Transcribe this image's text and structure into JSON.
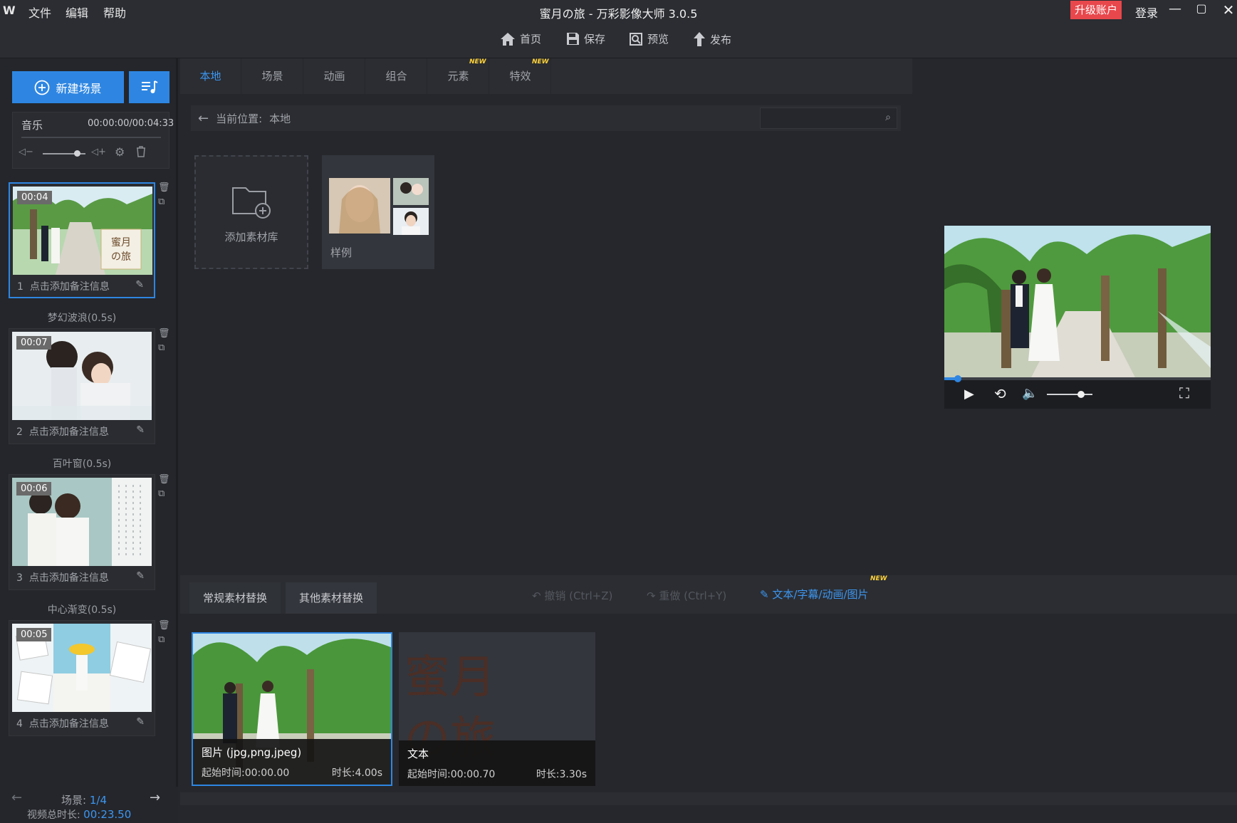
{
  "menu": {
    "app_logo": "W",
    "file": "文件",
    "edit": "编辑",
    "help": "帮助"
  },
  "window": {
    "title": "蜜月の旅 - 万彩影像大师 3.0.5",
    "upgrade": "升级账户",
    "login": "登录"
  },
  "toolbar": {
    "home": "首页",
    "save": "保存",
    "preview": "预览",
    "publish": "发布"
  },
  "left": {
    "new_scene": "新建场景",
    "music_label": "音乐",
    "music_time": "00:00:00/00:04:33",
    "music_volume": 0.8,
    "scenes": [
      {
        "time": "00:04",
        "num": "1",
        "note": "点击添加备注信息",
        "title_line1": "蜜月",
        "title_line2": "の旅"
      },
      {
        "time": "00:07",
        "num": "2",
        "note": "点击添加备注信息"
      },
      {
        "time": "00:06",
        "num": "3",
        "note": "点击添加备注信息"
      },
      {
        "time": "00:05",
        "num": "4",
        "note": "点击添加备注信息"
      }
    ],
    "transitions": [
      "梦幻波浪(0.5s)",
      "百叶窗(0.5s)",
      "中心渐变(0.5s)"
    ],
    "footer_scene_label": "场景:",
    "footer_scene_value": "1/4",
    "footer_duration_label": "视频总时长:",
    "footer_duration_value": "00:23.50"
  },
  "tabs": [
    "本地",
    "场景",
    "动画",
    "组合",
    "元素",
    "特效"
  ],
  "new_badge": "NEW",
  "breadcrumb": {
    "label": "当前位置:",
    "value": "本地"
  },
  "library": {
    "add": "添加素材库",
    "sample": "样例"
  },
  "player": {
    "progress": 0.05,
    "volume": 0.75
  },
  "bottom": {
    "tab1": "常规素材替换",
    "tab2": "其他素材替换",
    "undo": "撤销 (Ctrl+Z)",
    "redo": "重做 (Ctrl+Y)",
    "text_link": "文本/字幕/动画/图片"
  },
  "clips": [
    {
      "title": "图片 (jpg,png,jpeg)",
      "start": "起始时间:00:00.00",
      "duration": "时长:4.00s"
    },
    {
      "title": "文本",
      "start": "起始时间:00:00.70",
      "duration": "时长:3.30s",
      "bg_text1": "蜜月",
      "bg_text2": "の旅"
    }
  ]
}
